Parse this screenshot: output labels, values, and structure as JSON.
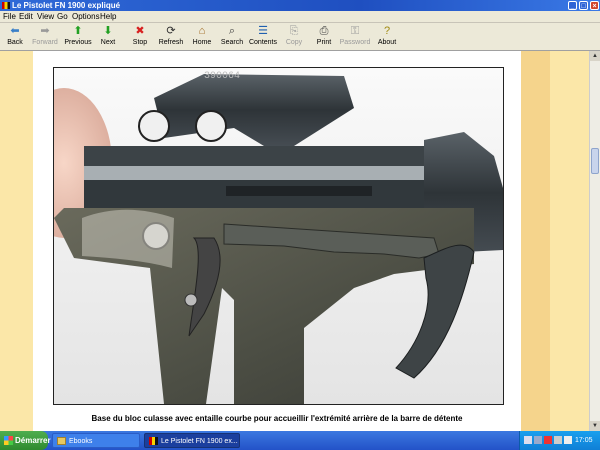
{
  "window": {
    "title": "Le Pistolet FN 1900 expliqué",
    "controls": {
      "minimize": "_",
      "maximize": "□",
      "close": "×"
    }
  },
  "menu": [
    "File",
    "Edit",
    "View",
    "Go",
    "Options",
    "Help"
  ],
  "toolbar": [
    {
      "label": "Back",
      "icon": "back-arrow-icon",
      "glyph": "⬅",
      "color": "#3a7fc8",
      "enabled": true
    },
    {
      "label": "Forward",
      "icon": "forward-arrow-icon",
      "glyph": "➡",
      "color": "#9a9a9a",
      "enabled": false
    },
    {
      "label": "Previous",
      "icon": "up-arrow-icon",
      "glyph": "⬆",
      "color": "#22a022",
      "enabled": true
    },
    {
      "label": "Next",
      "icon": "down-arrow-icon",
      "glyph": "⬇",
      "color": "#22a022",
      "enabled": true
    },
    {
      "label": "Stop",
      "icon": "stop-icon",
      "glyph": "✖",
      "color": "#d82020",
      "enabled": true
    },
    {
      "label": "Refresh",
      "icon": "refresh-icon",
      "glyph": "⟳",
      "color": "#303030",
      "enabled": true
    },
    {
      "label": "Home",
      "icon": "home-icon",
      "glyph": "⌂",
      "color": "#a06a20",
      "enabled": true
    },
    {
      "label": "Search",
      "icon": "search-icon",
      "glyph": "⌕",
      "color": "#404040",
      "enabled": true
    },
    {
      "label": "Contents",
      "icon": "contents-icon",
      "glyph": "☰",
      "color": "#2060b0",
      "enabled": true
    },
    {
      "label": "Copy",
      "icon": "copy-icon",
      "glyph": "⎘",
      "color": "#9a9a9a",
      "enabled": false
    },
    {
      "label": "Print",
      "icon": "print-icon",
      "glyph": "⎙",
      "color": "#404040",
      "enabled": true
    },
    {
      "label": "Password",
      "icon": "key-icon",
      "glyph": "⚿",
      "color": "#9a9a9a",
      "enabled": false
    },
    {
      "label": "About",
      "icon": "about-icon",
      "glyph": "?",
      "color": "#a08a10",
      "enabled": true
    }
  ],
  "content": {
    "serial_number": "390064",
    "caption": "Base du bloc culasse avec entaille courbe pour accueillir l'extrémité arrière de la barre de détente"
  },
  "taskbar": {
    "start_label": "Démarrer",
    "tasks": [
      {
        "label": "Ebooks",
        "active": false
      },
      {
        "label": "Le Pistolet FN 1900 ex...",
        "active": true
      }
    ],
    "clock": "17:05"
  }
}
